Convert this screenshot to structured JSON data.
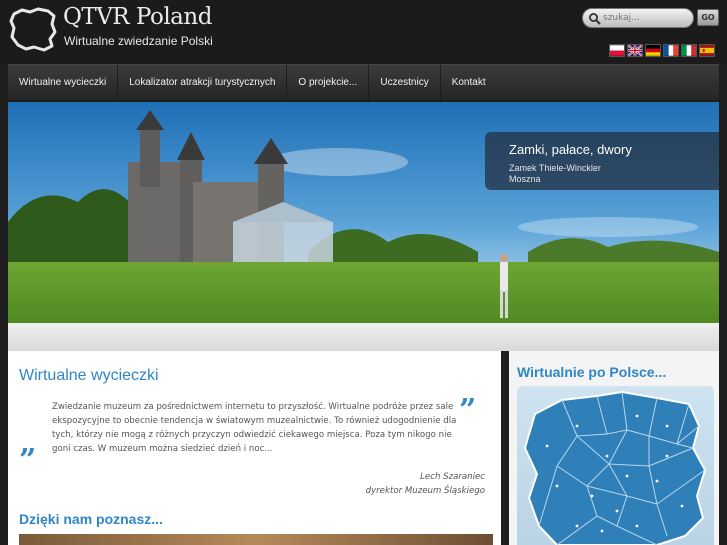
{
  "brand": {
    "title": "QTVR Poland",
    "subtitle": "Wirtualne zwiedzanie Polski"
  },
  "search": {
    "placeholder": "szukaj...",
    "go_label": "GO"
  },
  "languages": [
    {
      "name": "polish-flag-icon",
      "colors": [
        "#ffffff",
        "#dc143c"
      ]
    },
    {
      "name": "english-flag-icon",
      "colors": [
        "#012169",
        "#c8102e"
      ]
    },
    {
      "name": "german-flag-icon",
      "colors": [
        "#000000",
        "#dd0000",
        "#ffce00"
      ]
    },
    {
      "name": "french-flag-icon",
      "colors": [
        "#0055a4",
        "#ffffff",
        "#ef4135"
      ]
    },
    {
      "name": "italian-flag-icon",
      "colors": [
        "#009246",
        "#ffffff",
        "#ce2b37"
      ]
    },
    {
      "name": "spanish-flag-icon",
      "colors": [
        "#aa151b",
        "#f1bf00",
        "#aa151b"
      ]
    }
  ],
  "nav": {
    "items": [
      "Wirtualne wycieczki",
      "Lokalizator atrakcji turystycznych",
      "O projekcie...",
      "Uczestnicy",
      "Kontakt"
    ]
  },
  "hero": {
    "title": "Zamki, pałace, dwory",
    "subtitle_line1": "Zamek Thiele-Winckler",
    "subtitle_line2": "Moszna"
  },
  "tours": {
    "heading": "Wirtualne wycieczki",
    "quote": "Zwiedzanie muzeum za pośrednictwem internetu to przyszłość. Wirtualne podróże przez sale ekspozycyjne to obecnie tendencja w światowym muzealnictwie. To również udogodnienie dla tych, którzy nie mogą z różnych przyczyn odwiedzić ciekawego miejsca. Poza tym nikogo nie goni czas. W muzeum można siedzieć dzień i noc...",
    "quote_open": "”",
    "quote_close": "”",
    "author": "Lech Szaraniec",
    "author_role": "dyrektor Muzeum Śląskiego"
  },
  "learn": {
    "heading": "Dzięki nam poznasz..."
  },
  "sidebar": {
    "heading": "Wirtualnie po Polsce..."
  },
  "colors": {
    "accent": "#2f87c7",
    "header_bg": "#1b1b1b",
    "nav_bg": "#2e2e2e"
  }
}
